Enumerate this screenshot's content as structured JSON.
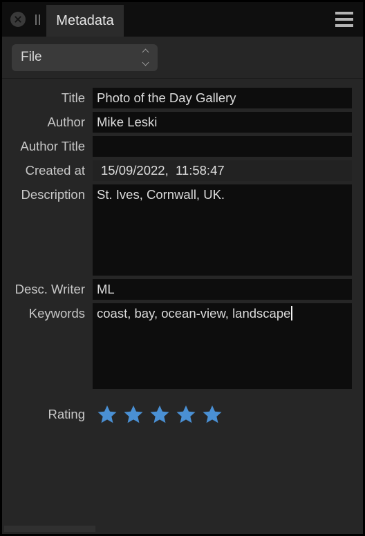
{
  "window": {
    "background": "#262626",
    "accent": "#4a90d4"
  },
  "tabbar": {
    "close_icon": "close-circle-icon",
    "pause_icon": "pause-bars-icon",
    "menu_icon": "hamburger-menu-icon",
    "tabs": [
      {
        "label": "Metadata",
        "active": true
      }
    ]
  },
  "toolbar": {
    "category_select": {
      "value": "File",
      "stepper_icon": "chevron-up-down-icon"
    }
  },
  "form": {
    "fields": [
      {
        "key": "title",
        "label": "Title",
        "value": "Photo of the Day Gallery",
        "type": "text",
        "readonly": false
      },
      {
        "key": "author",
        "label": "Author",
        "value": "Mike Leski",
        "type": "text",
        "readonly": false
      },
      {
        "key": "author_title",
        "label": "Author Title",
        "value": "",
        "type": "text",
        "readonly": false
      },
      {
        "key": "created_at",
        "label": "Created at",
        "value": "15/09/2022,  11:58:47",
        "type": "text",
        "readonly": true
      },
      {
        "key": "description",
        "label": "Description",
        "value": "St. Ives, Cornwall, UK.",
        "type": "textarea",
        "readonly": false
      },
      {
        "key": "desc_writer",
        "label": "Desc. Writer",
        "value": "ML",
        "type": "text",
        "readonly": false
      },
      {
        "key": "keywords",
        "label": "Keywords",
        "value": "coast, bay, ocean-view, landscape",
        "type": "textarea",
        "readonly": false,
        "focused": true
      }
    ]
  },
  "rating": {
    "label": "Rating",
    "value": 5,
    "max": 5,
    "star_color": "#4a90d4",
    "star_icon": "star-filled-icon"
  },
  "scrollbar": {
    "orientation": "horizontal",
    "thumb_fraction": 0.255
  }
}
